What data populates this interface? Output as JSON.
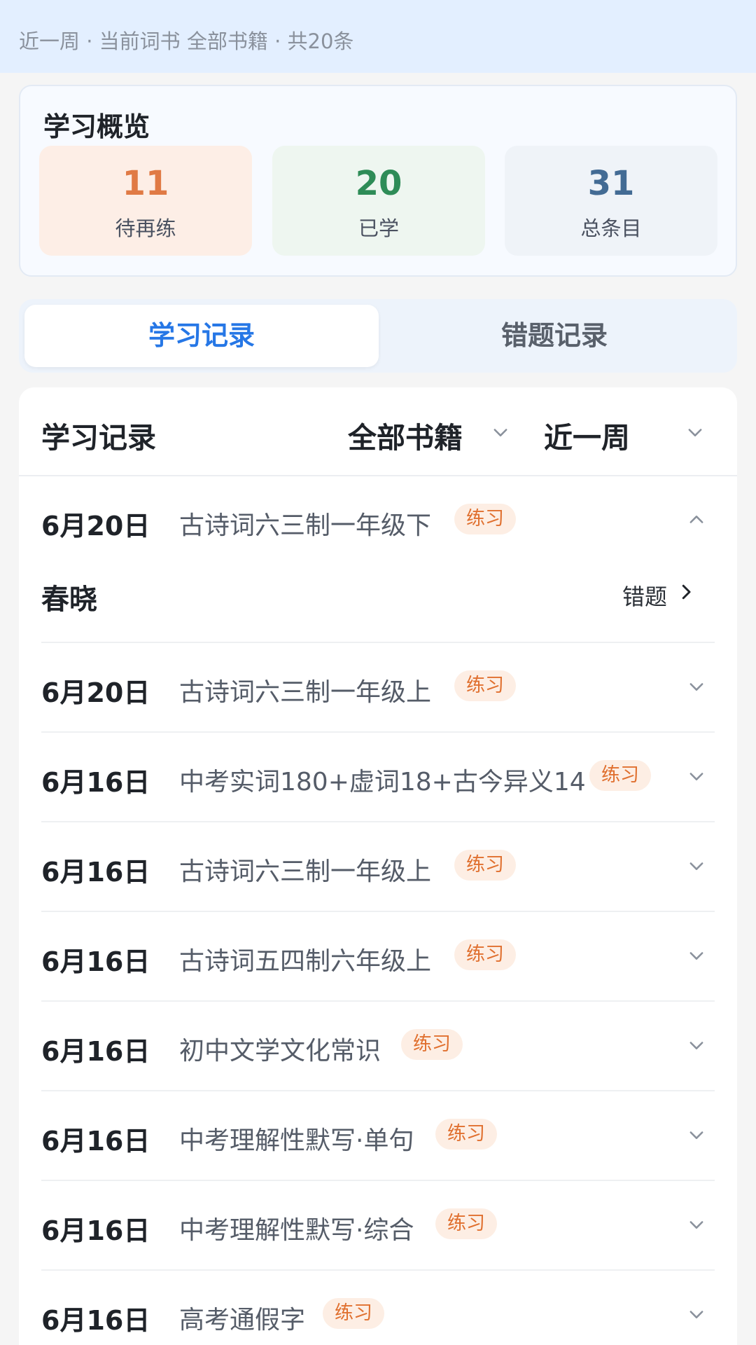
{
  "topbar": {
    "summary": "近一周 · 当前词书 全部书籍 · 共20条"
  },
  "overview": {
    "title": "学习概览",
    "stats": [
      {
        "value": "11",
        "label": "待再练"
      },
      {
        "value": "20",
        "label": "已学"
      },
      {
        "value": "31",
        "label": "总条目"
      }
    ]
  },
  "tabs": [
    {
      "label": "学习记录",
      "active": true
    },
    {
      "label": "错题记录",
      "active": false
    }
  ],
  "records": {
    "title": "学习记录",
    "filter_book": "全部书籍",
    "filter_period": "近一周",
    "expanded_item": {
      "title": "春晓",
      "link": "错题"
    },
    "items": [
      {
        "date": "6月20日",
        "book": "古诗词六三制一年级下",
        "tag": "练习",
        "expanded": true
      },
      {
        "date": "6月20日",
        "book": "古诗词六三制一年级上",
        "tag": "练习"
      },
      {
        "date": "6月16日",
        "book": "中考实词180+虚词18+古今异义14",
        "tag": "练习"
      },
      {
        "date": "6月16日",
        "book": "古诗词六三制一年级上",
        "tag": "练习"
      },
      {
        "date": "6月16日",
        "book": "古诗词五四制六年级上",
        "tag": "练习"
      },
      {
        "date": "6月16日",
        "book": "初中文学文化常识",
        "tag": "练习"
      },
      {
        "date": "6月16日",
        "book": "中考理解性默写·单句",
        "tag": "练习"
      },
      {
        "date": "6月16日",
        "book": "中考理解性默写·综合",
        "tag": "练习"
      },
      {
        "date": "6月16日",
        "book": "高考通假字",
        "tag": "练习"
      }
    ]
  },
  "colors": {
    "accent": "#2677e6",
    "tag_text": "#e0702f",
    "tag_bg": "#fdeee4",
    "topbar_bg": "#e3efff"
  }
}
